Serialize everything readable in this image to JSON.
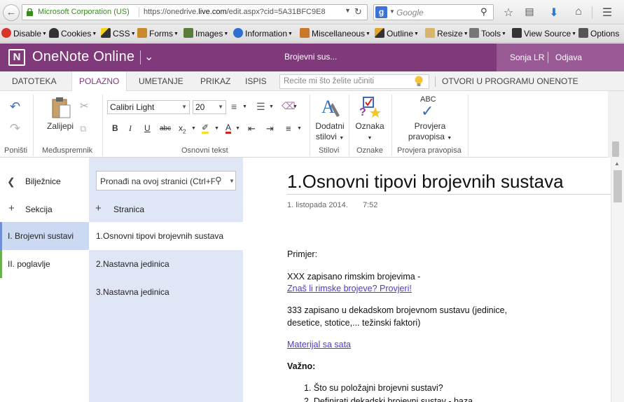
{
  "browser": {
    "identity": "Microsoft Corporation (US)",
    "url_prefix": "https://onedrive.",
    "url_domain": "live.com",
    "url_suffix": "/edit.aspx?cid=5A31BFC9E8",
    "search_placeholder": "Google"
  },
  "devbar": {
    "items": [
      "Disable",
      "Cookies",
      "CSS",
      "Forms",
      "Images",
      "Information",
      "Miscellaneous",
      "Outline",
      "Resize",
      "Tools",
      "View Source",
      "Options"
    ]
  },
  "app": {
    "name": "OneNote Online",
    "doc_title": "Brojevni sus...",
    "user": "Sonja LR",
    "signout": "Odjava"
  },
  "tabs": [
    "DATOTEKA",
    "POLAZNO",
    "UMETANJE",
    "PRIKAZ",
    "ISPIS"
  ],
  "active_tab": "POLAZNO",
  "tell_me_placeholder": "Recite mi što želite učiniti",
  "open_in_app": "OTVORI U PROGRAMU ONENOTE",
  "ribbon": {
    "groups": {
      "undo": "Poništi",
      "clipboard": "Međuspremnik",
      "basic_text": "Osnovni tekst",
      "styles": "Stilovi",
      "tags": "Oznake",
      "spelling": "Provjera pravopisa"
    },
    "paste": "Zalijepi",
    "font": "Calibri Light",
    "size": "20",
    "styles_btn_line1": "Dodatni",
    "styles_btn_line2": "stilovi",
    "tag_btn": "Oznaka",
    "spell_btn_line1": "Provjera",
    "spell_btn_line2": "pravopisa",
    "spell_icon_text": "ABC"
  },
  "notebook": {
    "back_label": "Bilježnice",
    "add_section": "Sekcija",
    "sections": [
      "I. Brojevni sustavi",
      "II. poglavlje"
    ]
  },
  "pages": {
    "find_placeholder": "Pronađi na ovoj stranici (Ctrl+F)",
    "add_page": "Stranica",
    "items": [
      "1.Osnovni tipovi brojevnih sustava",
      "2.Nastavna jedinica",
      "3.Nastavna jedinica"
    ]
  },
  "page": {
    "title": "1.Osnovni tipovi brojevnih sustava",
    "date": "1. listopada 2014.",
    "time": "7:52",
    "p1": "Primjer:",
    "p2": "XXX zapisano rimskim brojevima -",
    "p2_link": "Znaš li rimske brojeve? Provjeri!",
    "p3_line1": "333 zapisano u dekadskom brojevnom sustavu (jedinice,",
    "p3_line2": "desetice, stotice,... težinski faktori)",
    "link2": "Materijal sa sata",
    "p4": "Važno:",
    "list": [
      "1. Što su položajni brojevni sustavi?",
      "2. Definirati dekadski brojevni sustav - baza"
    ]
  }
}
